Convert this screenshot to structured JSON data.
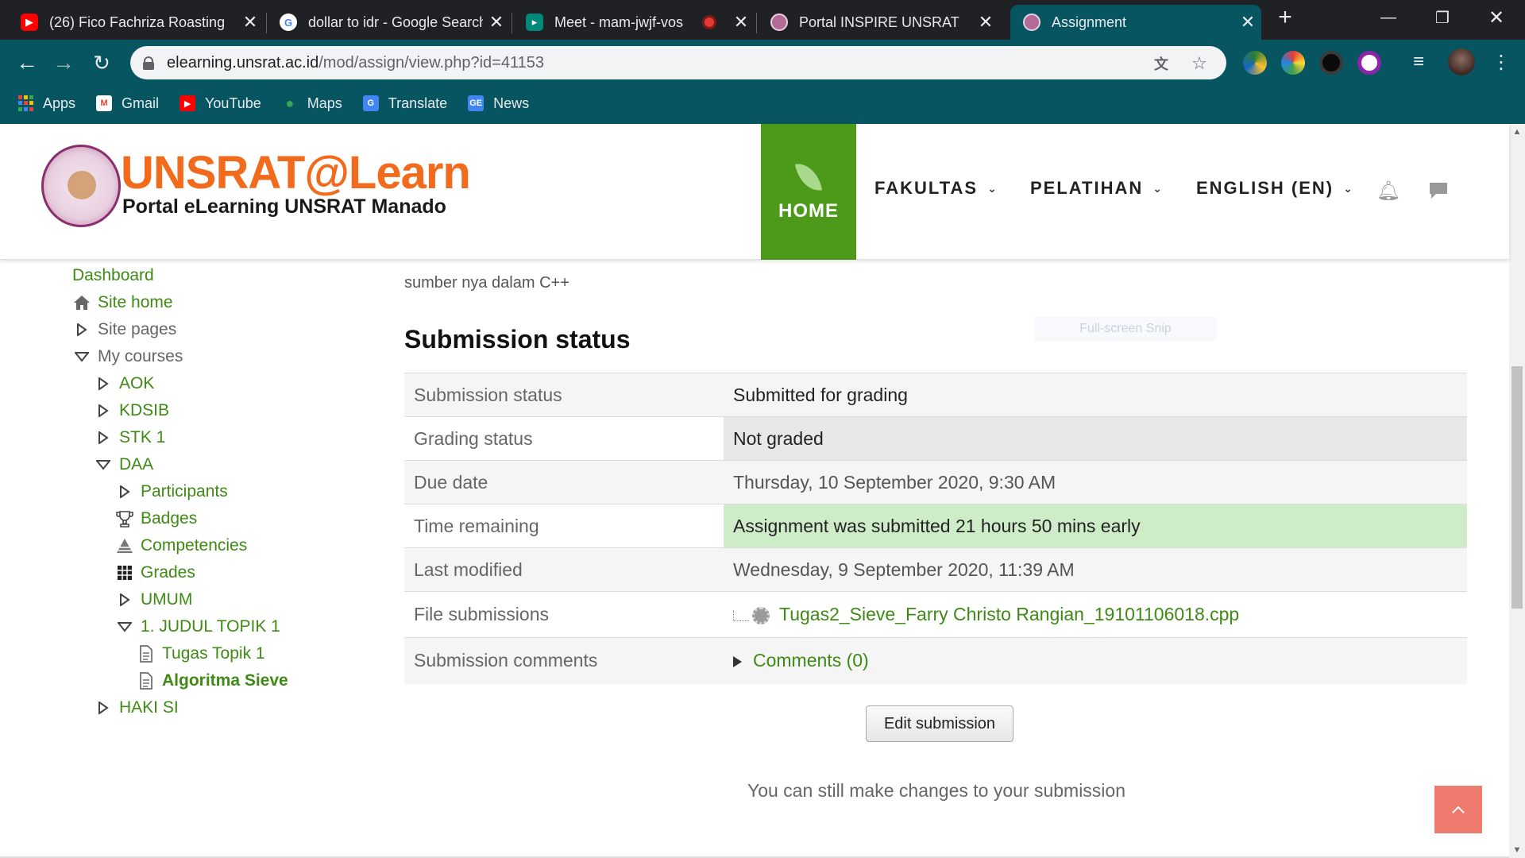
{
  "browser": {
    "tabs": [
      {
        "title": "(26) Fico Fachriza Roasting",
        "favicon": "youtube-favicon",
        "color": "#ff0000"
      },
      {
        "title": "dollar to idr - Google Search",
        "favicon": "google-favicon",
        "color": "#4285f4"
      },
      {
        "title": "Meet - mam-jwjf-vos",
        "favicon": "meet-favicon",
        "color": "#00897b",
        "recording": true
      },
      {
        "title": "Portal INSPIRE UNSRAT",
        "favicon": "unsrat-favicon",
        "color": "#b36a97"
      },
      {
        "title": "Assignment",
        "favicon": "unsrat-favicon",
        "color": "#b36a97",
        "active": true
      }
    ],
    "url_host": "elearning.unsrat.ac.id",
    "url_path": "/mod/assign/view.php?id=41153",
    "bookmarks": [
      {
        "label": "Apps",
        "icon": "apps-grid-icon"
      },
      {
        "label": "Gmail",
        "icon": "gmail-icon"
      },
      {
        "label": "YouTube",
        "icon": "youtube-icon"
      },
      {
        "label": "Maps",
        "icon": "maps-pin-icon"
      },
      {
        "label": "Translate",
        "icon": "translate-icon"
      },
      {
        "label": "News",
        "icon": "news-icon"
      }
    ],
    "colors": {
      "frame": "#202124",
      "toolbar": "#075560"
    }
  },
  "site": {
    "logo_title": "UNSRAT@Learn",
    "logo_subtitle": "Portal eLearning UNSRAT Manado",
    "home_label": "HOME",
    "nav": [
      {
        "label": "FAKULTAS"
      },
      {
        "label": "PELATIHAN"
      },
      {
        "label": "ENGLISH (EN)"
      }
    ],
    "colors": {
      "brand_orange": "#f26a1b",
      "home_green": "#4d9a1b",
      "link_green": "#3e8a14"
    }
  },
  "sidebar": {
    "items": [
      {
        "label": "Dashboard",
        "icon": "none"
      },
      {
        "label": "Site home",
        "icon": "home-icon"
      },
      {
        "label": "Site pages",
        "icon": "collapsed-triangle-icon"
      },
      {
        "label": "My courses",
        "icon": "expanded-triangle-icon"
      },
      {
        "label": "AOK",
        "icon": "collapsed-triangle-icon"
      },
      {
        "label": "KDSIB",
        "icon": "collapsed-triangle-icon"
      },
      {
        "label": "STK 1",
        "icon": "collapsed-triangle-icon"
      },
      {
        "label": "DAA",
        "icon": "expanded-triangle-icon"
      },
      {
        "label": "Participants",
        "icon": "collapsed-triangle-icon"
      },
      {
        "label": "Badges",
        "icon": "trophy-icon"
      },
      {
        "label": "Competencies",
        "icon": "pyramid-icon"
      },
      {
        "label": "Grades",
        "icon": "grid-icon"
      },
      {
        "label": "UMUM",
        "icon": "collapsed-triangle-icon"
      },
      {
        "label": "1. JUDUL TOPIK 1",
        "icon": "expanded-triangle-icon"
      },
      {
        "label": "Tugas Topik 1",
        "icon": "document-icon"
      },
      {
        "label": "Algoritma Sieve",
        "icon": "document-icon"
      },
      {
        "label": "HAKI SI",
        "icon": "collapsed-triangle-icon"
      }
    ]
  },
  "main": {
    "intro_text": "sumber nya dalam C++",
    "section_title": "Submission status",
    "rows": [
      {
        "label": "Submission status",
        "value": "Submitted for grading"
      },
      {
        "label": "Grading status",
        "value": "Not graded"
      },
      {
        "label": "Due date",
        "value": "Thursday, 10 September 2020, 9:30 AM"
      },
      {
        "label": "Time remaining",
        "value": "Assignment was submitted 21 hours 50 mins early"
      },
      {
        "label": "Last modified",
        "value": "Wednesday, 9 September 2020, 11:39 AM"
      },
      {
        "label": "File submissions",
        "value": "Tugas2_Sieve_Farry Christo Rangian_19101106018.cpp"
      },
      {
        "label": "Submission comments",
        "value": "Comments (0)"
      }
    ],
    "edit_button": "Edit submission",
    "edit_note": "You can still make changes to your submission",
    "snip_overlay": "Full-screen Snip"
  }
}
